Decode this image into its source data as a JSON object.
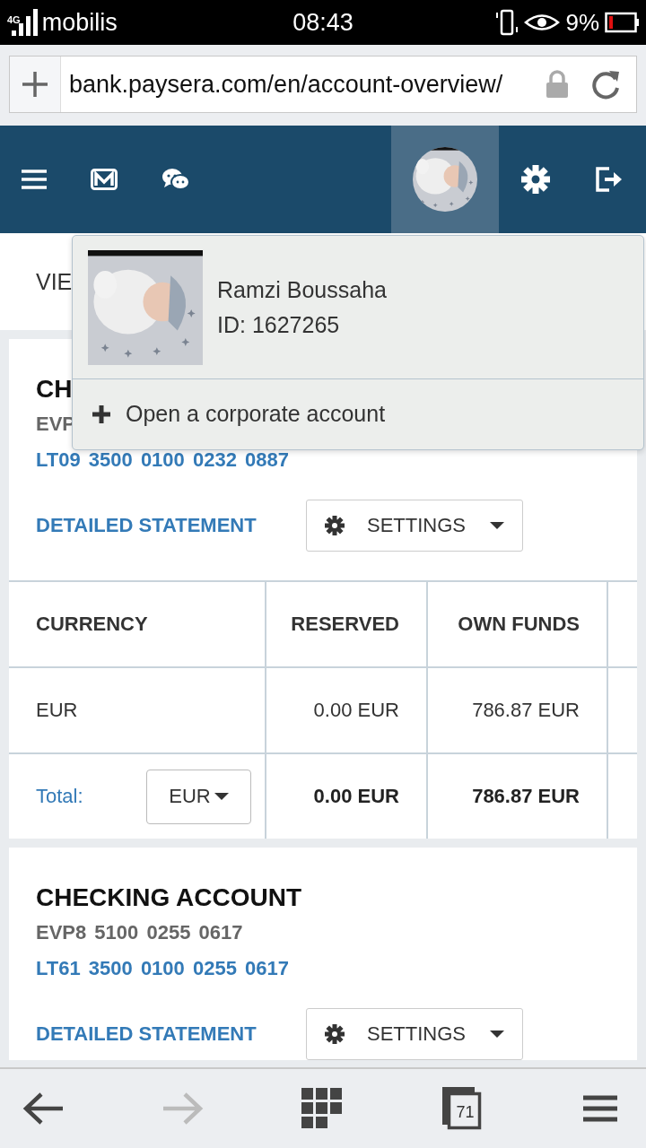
{
  "status_bar": {
    "network": "4G",
    "carrier": "mobilis",
    "time": "08:43",
    "battery": "9%"
  },
  "address_bar": {
    "url": "bank.paysera.com/en/account-overview/"
  },
  "profile_menu": {
    "expanded": true,
    "name": "Ramzi Boussaha",
    "id": "ID: 1627265",
    "action": "Open a corporate account"
  },
  "view_strip": {
    "label": "VIE"
  },
  "accounts": [
    {
      "title": "CH",
      "number": "EVP",
      "iban": "LT09 3500 0100 0232 0887",
      "statement_link": "DETAILED STATEMENT",
      "settings_button": "SETTINGS",
      "table": {
        "columns": [
          "CURRENCY",
          "RESERVED",
          "OWN FUNDS"
        ],
        "rows": [
          [
            "EUR",
            "0.00 EUR",
            "786.87 EUR"
          ]
        ],
        "total": {
          "label": "Total:",
          "currency": "EUR",
          "reserved": "0.00 EUR",
          "own_funds": "786.87 EUR"
        }
      }
    },
    {
      "title": "CHECKING ACCOUNT",
      "number": "EVP8 5100 0255 0617",
      "iban": "LT61 3500 0100 0255 0617",
      "statement_link": "DETAILED STATEMENT",
      "settings_button": "SETTINGS"
    }
  ],
  "toolbar": {
    "items": [
      {
        "kind": "back",
        "disabled": false
      },
      {
        "kind": "forward",
        "disabled": true
      },
      {
        "kind": "grid",
        "disabled": false
      },
      {
        "kind": "tabs",
        "count": "71",
        "disabled": false
      },
      {
        "kind": "menu",
        "disabled": false
      }
    ]
  }
}
